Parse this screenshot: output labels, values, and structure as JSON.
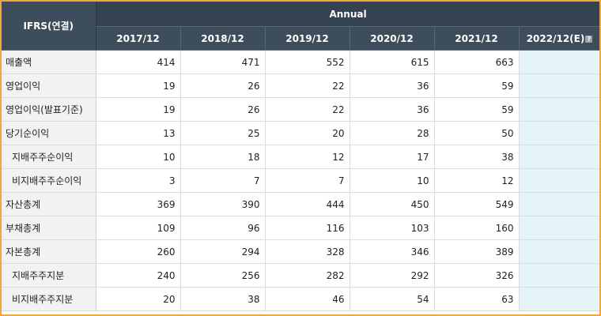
{
  "table": {
    "label_header": "IFRS(연결)",
    "group_header": "Annual",
    "years": [
      "2017/12",
      "2018/12",
      "2019/12",
      "2020/12",
      "2021/12"
    ],
    "estimate_header": "2022/12(E)",
    "estimate_icon": "help-icon",
    "rows": [
      {
        "label": "매출액",
        "values": [
          "414",
          "471",
          "552",
          "615",
          "663"
        ],
        "estimate": ""
      },
      {
        "label": "영업이익",
        "values": [
          "19",
          "26",
          "22",
          "36",
          "59"
        ],
        "estimate": ""
      },
      {
        "label": "영업이익(발표기준)",
        "values": [
          "19",
          "26",
          "22",
          "36",
          "59"
        ],
        "estimate": ""
      },
      {
        "label": "당기순이익",
        "values": [
          "13",
          "25",
          "20",
          "28",
          "50"
        ],
        "estimate": ""
      },
      {
        "label": "지배주주순이익",
        "values": [
          "10",
          "18",
          "12",
          "17",
          "38"
        ],
        "estimate": ""
      },
      {
        "label": "비지배주주순이익",
        "values": [
          "3",
          "7",
          "7",
          "10",
          "12"
        ],
        "estimate": ""
      },
      {
        "label": "자산총계",
        "values": [
          "369",
          "390",
          "444",
          "450",
          "549"
        ],
        "estimate": ""
      },
      {
        "label": "부채총계",
        "values": [
          "109",
          "96",
          "116",
          "103",
          "160"
        ],
        "estimate": ""
      },
      {
        "label": "자본총계",
        "values": [
          "260",
          "294",
          "328",
          "346",
          "389"
        ],
        "estimate": ""
      },
      {
        "label": "지배주주지분",
        "values": [
          "240",
          "256",
          "282",
          "292",
          "326"
        ],
        "estimate": ""
      },
      {
        "label": "비지배주주지분",
        "values": [
          "20",
          "38",
          "46",
          "54",
          "63"
        ],
        "estimate": ""
      }
    ]
  },
  "colors": {
    "header_bg": "#3d4d5b",
    "frame_border": "#f3a83c",
    "label_bg": "#f1f2f4",
    "estimate_bg": "#e5f4f8"
  }
}
